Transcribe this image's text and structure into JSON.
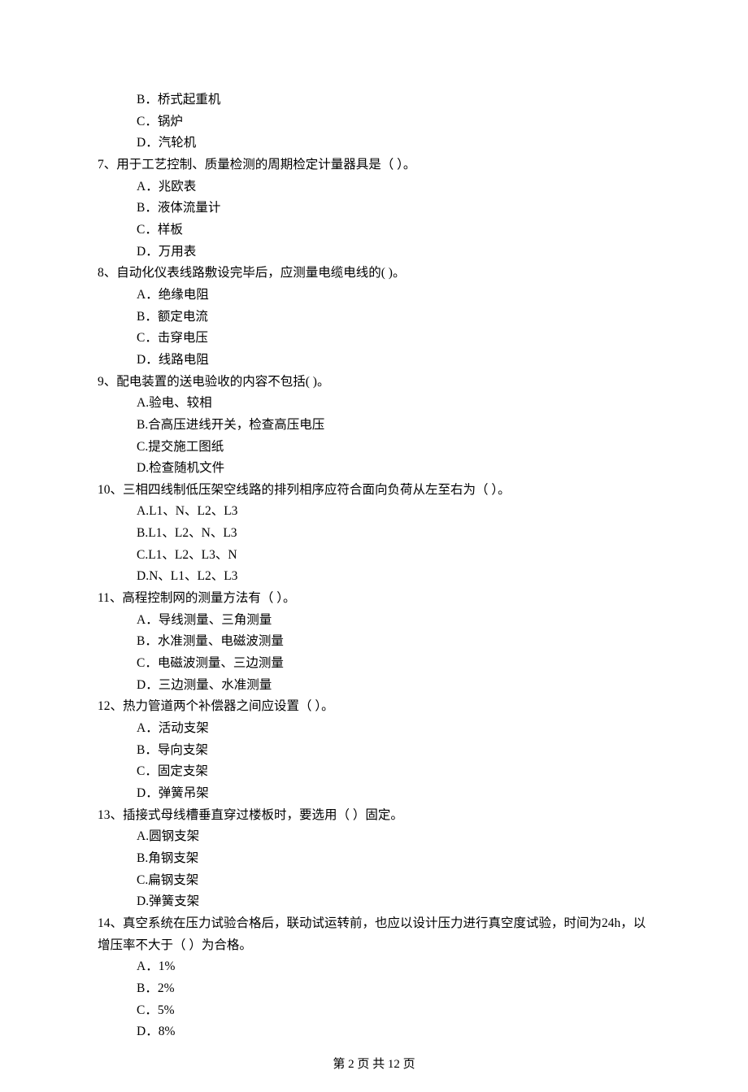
{
  "options_cont": [
    "B．桥式起重机",
    "C．锅炉",
    "D．汽轮机"
  ],
  "questions": [
    {
      "stem": "7、用于工艺控制、质量检测的周期检定计量器具是（    ）。",
      "options": [
        "A．兆欧表",
        "B．液体流量计",
        "C．样板",
        "D．万用表"
      ]
    },
    {
      "stem": "8、自动化仪表线路敷设完毕后，应测量电缆电线的(    )。",
      "options": [
        "A．绝缘电阻",
        "B．额定电流",
        "C．击穿电压",
        "D．线路电阻"
      ]
    },
    {
      "stem": "9、配电装置的送电验收的内容不包括(    )。",
      "options": [
        "A.验电、较相",
        "B.合高压进线开关，检查高压电压",
        "C.提交施工图纸",
        "D.检查随机文件"
      ]
    },
    {
      "stem": "10、三相四线制低压架空线路的排列相序应符合面向负荷从左至右为（    ）。",
      "options": [
        "A.L1、N、L2、L3",
        "B.L1、L2、N、L3",
        "C.L1、L2、L3、N",
        "D.N、L1、L2、L3"
      ]
    },
    {
      "stem": "11、高程控制网的测量方法有（    ）。",
      "options": [
        "A．导线测量、三角测量",
        "B．水准测量、电磁波测量",
        "C．电磁波测量、三边测量",
        "D．三边测量、水准测量"
      ]
    },
    {
      "stem": "12、热力管道两个补偿器之间应设置（    ）。",
      "options": [
        "A．活动支架",
        "B．导向支架",
        "C．固定支架",
        "D．弹簧吊架"
      ]
    },
    {
      "stem": "13、插接式母线槽垂直穿过楼板时，要选用（    ）固定。",
      "options": [
        "A.圆钢支架",
        "B.角钢支架",
        "C.扁钢支架",
        "D.弹簧支架"
      ]
    },
    {
      "stem": "14、真空系统在压力试验合格后，联动试运转前，也应以设计压力进行真空度试验，时间为24h，以增压率不大于（    ）为合格。",
      "options": [
        "A．1%",
        "B．2%",
        "C．5%",
        "D．8%"
      ]
    }
  ],
  "footer": "第 2 页 共 12 页"
}
